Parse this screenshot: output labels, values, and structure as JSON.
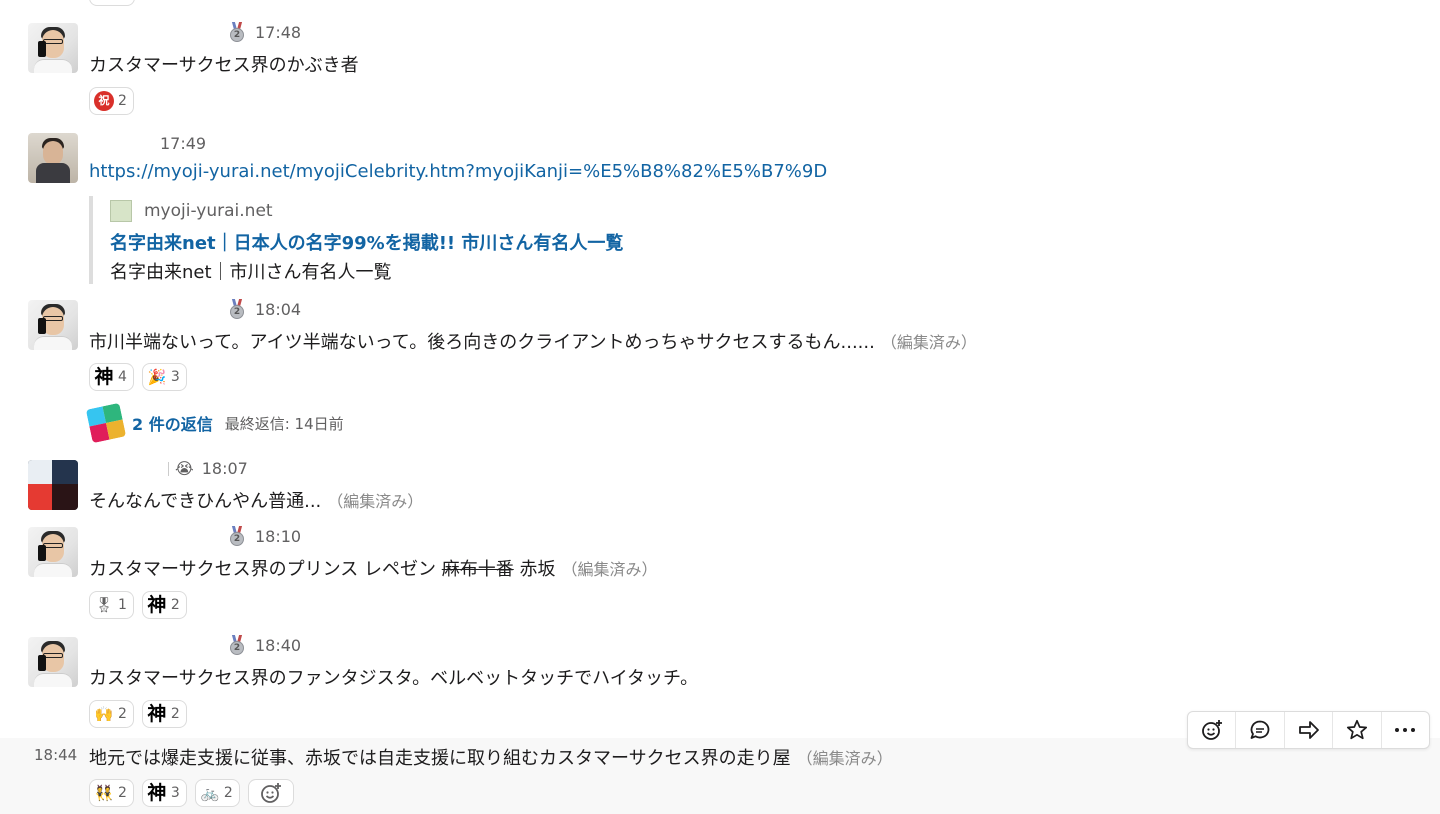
{
  "messages": [
    {
      "time": "17:48",
      "text": "カスタマーサクセス界のかぶき者",
      "reactions": [
        {
          "emoji": "祝",
          "count": "2"
        }
      ]
    },
    {
      "time": "17:49",
      "link": "https://myoji-yurai.net/myojiCelebrity.htm?myojiKanji=%E5%B8%82%E5%B7%9D",
      "attachment": {
        "site": "myoji-yurai.net",
        "title": "名字由来net｜日本人の名字99%を掲載!! 市川さん有名人一覧",
        "description": "名字由来net｜市川さん有名人一覧"
      }
    },
    {
      "time": "18:04",
      "text": "市川半端ないって。アイツ半端ないって。後ろ向きのクライアントめっちゃサクセスするもん......",
      "edited": "（編集済み）",
      "reactions": [
        {
          "emoji": "神",
          "count": "4"
        },
        {
          "emoji": "🎉",
          "count": "3"
        }
      ],
      "thread": {
        "count": "2 件の返信",
        "last": "最終返信: 14日前"
      }
    },
    {
      "time": "18:07",
      "status_emoji": "😭",
      "text": "そんなんできひんやん普通...",
      "edited": "（編集済み）"
    },
    {
      "time": "18:10",
      "text_a": "カスタマーサクセス界のプリンス レペゼン ",
      "text_strike": "麻布十番",
      "text_b": " 赤坂",
      "edited": "（編集済み）",
      "reactions": [
        {
          "emoji": "🎖",
          "count": "1"
        },
        {
          "emoji": "神",
          "count": "2"
        }
      ]
    },
    {
      "time": "18:40",
      "text": "カスタマーサクセス界のファンタジスタ。ベルベットタッチでハイタッチ。",
      "reactions": [
        {
          "emoji": "🙌",
          "count": "2"
        },
        {
          "emoji": "神",
          "count": "2"
        }
      ]
    },
    {
      "time": "18:44",
      "text": "地元では爆走支援に従事、赤坂では自走支援に取り組むカスタマーサクセス界の走り屋",
      "edited": "（編集済み）",
      "reactions": [
        {
          "emoji": "👯",
          "count": "2"
        },
        {
          "emoji": "神",
          "count": "3"
        },
        {
          "emoji": "🚲",
          "count": "2"
        }
      ]
    }
  ],
  "toolbar": [
    "add-reaction-icon",
    "start-thread-icon",
    "share-message-icon",
    "star-icon",
    "more-actions-icon"
  ],
  "colors": {
    "link": "#1264a3",
    "hover_bg": "#f8f8f8",
    "reaction_border": "#dcdcdc"
  }
}
